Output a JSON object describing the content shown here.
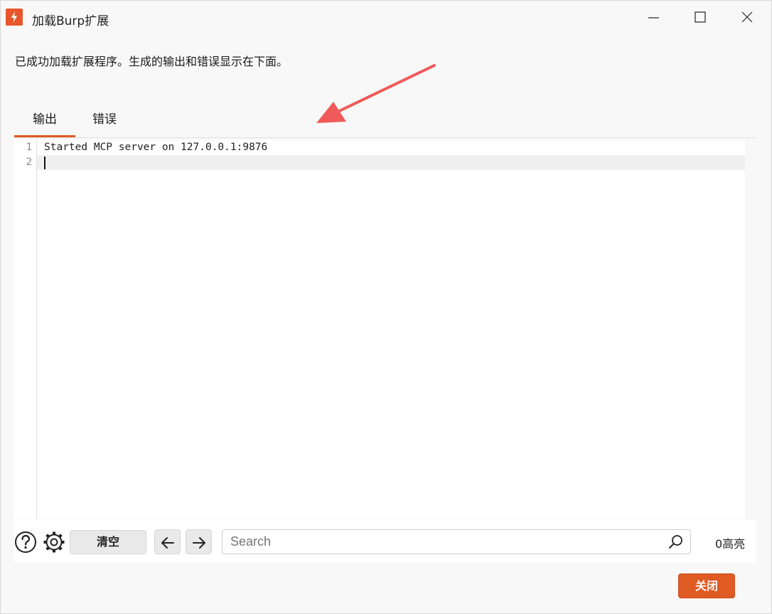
{
  "window": {
    "title": "加载Burp扩展",
    "controls": [
      "minimize",
      "maximize",
      "close"
    ]
  },
  "message": "已成功加载扩展程序。生成的输出和错误显示在下面。",
  "tabs": [
    {
      "label": "输出",
      "active": true
    },
    {
      "label": "错误",
      "active": false
    }
  ],
  "editor": {
    "lines": [
      {
        "number": "1",
        "text": "Started MCP server on 127.0.0.1:9876"
      },
      {
        "number": "2",
        "text": ""
      }
    ]
  },
  "toolbar": {
    "help_icon": "help-icon",
    "settings_icon": "gear-icon",
    "clear_label": "清空",
    "prev_icon": "arrow-left-icon",
    "next_icon": "arrow-right-icon",
    "search_placeholder": "Search",
    "highlight_count": "0高亮"
  },
  "footer": {
    "close_label": "关闭"
  },
  "colors": {
    "accent": "#e05a23",
    "annotation_arrow": "#f05a5a"
  }
}
